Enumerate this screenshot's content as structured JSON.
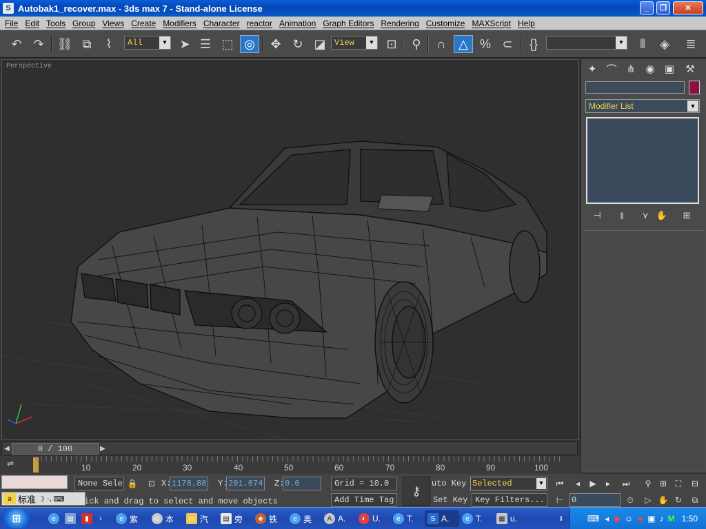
{
  "window": {
    "title": "Autobak1_recover.max - 3ds max 7 - Stand-alone License"
  },
  "menu": [
    "File",
    "Edit",
    "Tools",
    "Group",
    "Views",
    "Create",
    "Modifiers",
    "Character",
    "reactor",
    "Animation",
    "Graph Editors",
    "Rendering",
    "Customize",
    "MAXScript",
    "Help"
  ],
  "toolbar": {
    "filter_value": "All",
    "refcoord_value": "View"
  },
  "viewport": {
    "label": "Perspective"
  },
  "panel": {
    "modifier_list": "Modifier List",
    "object_color": "#8a1040"
  },
  "timeslider": {
    "text": "0 / 100"
  },
  "trackbar": {
    "ticks": [
      "10",
      "20",
      "30",
      "40",
      "50",
      "60",
      "70",
      "80",
      "90",
      "100"
    ]
  },
  "status": {
    "selection": "None Sele",
    "x_label": "X:",
    "x_value": "1178.88",
    "y_label": "Y:",
    "y_value": "201.074",
    "z_label": "Z:",
    "z_value": "0.0",
    "grid": "Grid = 10.0",
    "prompt": "ick and drag to select and move objects",
    "add_time_tag": "Add Time Tag",
    "auto_key": "uto Key",
    "selected_value": "Selected",
    "set_key": "Set Key",
    "key_filters": "Key Filters...",
    "frame_value": "0",
    "ime": "标准"
  },
  "taskbar": {
    "items": [
      "紫",
      "本",
      "汽",
      "旁",
      "铁",
      "奥",
      "A.",
      "U.",
      "T.",
      "A.",
      "T.",
      "u."
    ],
    "clock": "1:50"
  }
}
